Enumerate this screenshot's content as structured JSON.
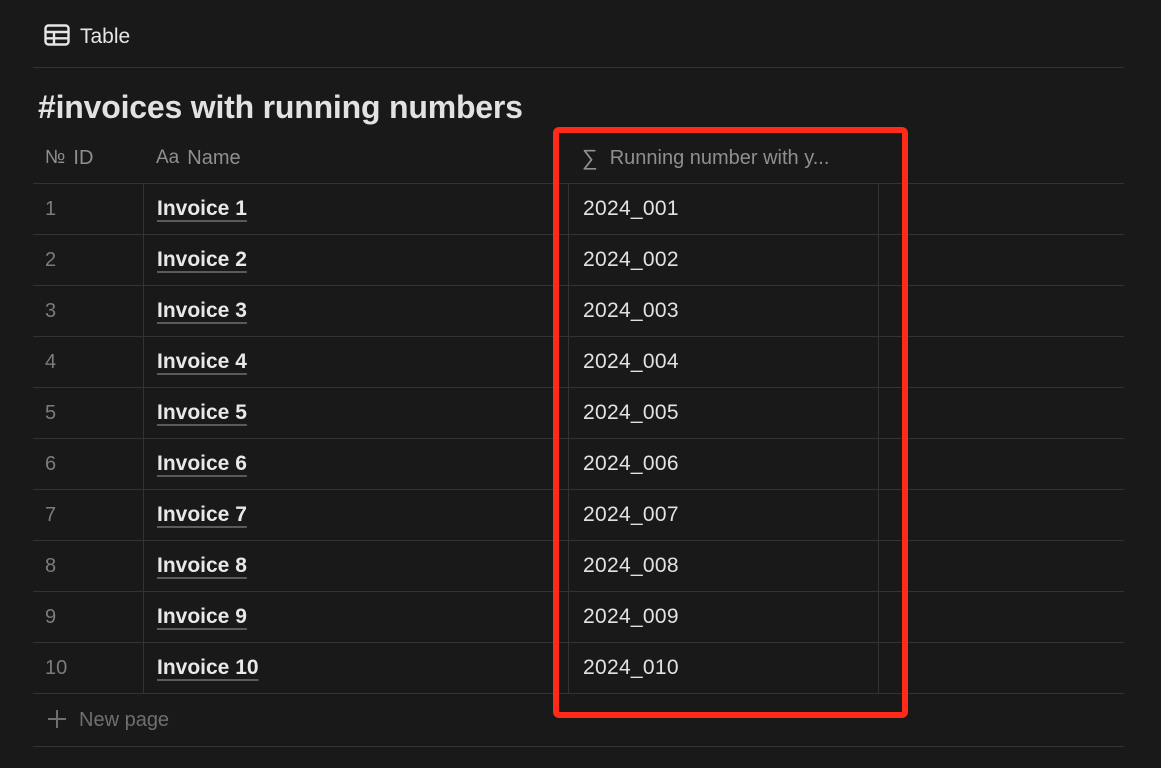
{
  "view": {
    "icon": "table-icon",
    "label": "Table"
  },
  "database": {
    "title": "#invoices with running numbers"
  },
  "columns": {
    "id": {
      "icon": "number-sign-icon",
      "glyph": "№",
      "label": "ID"
    },
    "name": {
      "icon": "text-property-icon",
      "glyph": "Aa",
      "label": "Name"
    },
    "running": {
      "icon": "formula-sigma-icon",
      "glyph": "∑",
      "label": "Running number with y..."
    }
  },
  "rows": [
    {
      "id": "1",
      "name": "Invoice 1",
      "running": "2024_001"
    },
    {
      "id": "2",
      "name": "Invoice 2",
      "running": "2024_002"
    },
    {
      "id": "3",
      "name": "Invoice 3",
      "running": "2024_003"
    },
    {
      "id": "4",
      "name": "Invoice 4",
      "running": "2024_004"
    },
    {
      "id": "5",
      "name": "Invoice 5",
      "running": "2024_005"
    },
    {
      "id": "6",
      "name": "Invoice 6",
      "running": "2024_006"
    },
    {
      "id": "7",
      "name": "Invoice 7",
      "running": "2024_007"
    },
    {
      "id": "8",
      "name": "Invoice 8",
      "running": "2024_008"
    },
    {
      "id": "9",
      "name": "Invoice 9",
      "running": "2024_009"
    },
    {
      "id": "10",
      "name": "Invoice 10",
      "running": "2024_010"
    }
  ],
  "new_page": {
    "icon": "plus-icon",
    "label": "New page"
  },
  "colors": {
    "background": "#191919",
    "highlight": "#ff2a1a"
  }
}
